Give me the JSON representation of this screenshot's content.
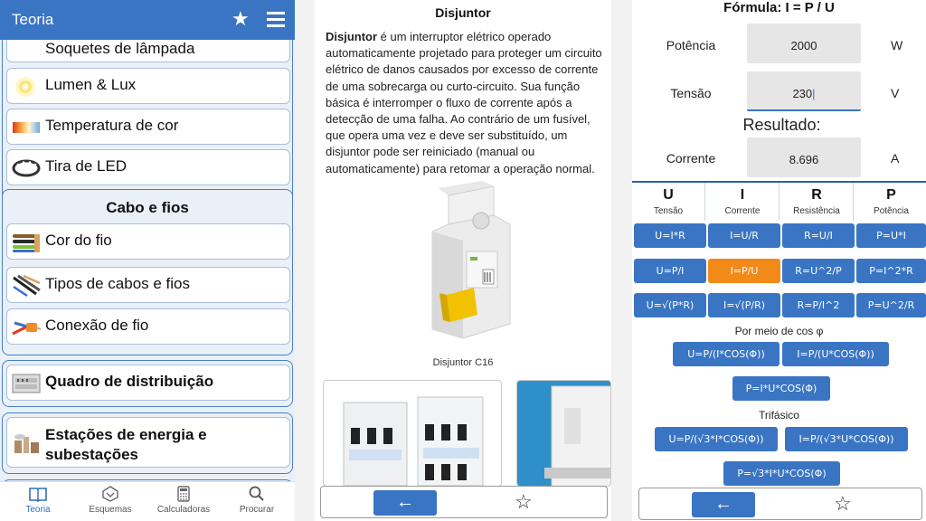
{
  "panel1": {
    "appbar": {
      "title": "Teoria",
      "star_icon": "star-icon",
      "menu_icon": "hamburger-menu-icon"
    },
    "group1_items": [
      {
        "label": "Soquetes de lâmpada",
        "icon": "lamp-socket-icon"
      },
      {
        "label": "Lumen & Lux",
        "icon": "light-bulb-icon"
      },
      {
        "label": "Temperatura de cor",
        "icon": "color-gradient-icon"
      },
      {
        "label": "Tira de LED",
        "icon": "led-strip-icon"
      }
    ],
    "group2": {
      "title": "Cabo e fios",
      "items": [
        {
          "label": "Cor do fio",
          "icon": "wire-colors-icon"
        },
        {
          "label": "Tipos de cabos e fios",
          "icon": "cable-types-icon"
        },
        {
          "label": "Conexão de fio",
          "icon": "wire-connection-icon"
        }
      ]
    },
    "group3_item": {
      "label": "Quadro de distribuição",
      "icon": "distribution-board-icon"
    },
    "group4_item": {
      "label_line1": "Estações de energia e",
      "label_line2": "subestações",
      "icon": "power-station-icon"
    },
    "bottom_nav": [
      {
        "label": "Teoria",
        "icon": "book-icon",
        "active": true
      },
      {
        "label": "Esquemas",
        "icon": "schematic-icon",
        "active": false
      },
      {
        "label": "Calculadoras",
        "icon": "calculator-icon",
        "active": false
      },
      {
        "label": "Procurar",
        "icon": "search-icon",
        "active": false
      }
    ]
  },
  "panel2": {
    "title": "Disjuntor",
    "body_term": "Disjuntor",
    "body_text": " é um interruptor elétrico operado automaticamente projetado para proteger um circuito elétrico de danos causados por excesso de corrente de uma sobrecarga ou curto-circuito. Sua função básica é interromper o fluxo de corrente após a detecção de uma falha. Ao contrário de um fusível, que opera uma vez e deve ser substituído, um disjuntor pode ser reiniciado (manual ou automaticamente) para retomar a operação normal.",
    "image_caption": "Disjuntor C16",
    "back_icon": "arrow-left-icon",
    "favorite_icon": "star-outline-icon"
  },
  "panel3": {
    "formula": "Fórmula: I = P / U",
    "inputs": [
      {
        "label": "Potência",
        "value": "2000",
        "unit": "W"
      },
      {
        "label": "Tensão",
        "value": "230",
        "unit": "V"
      }
    ],
    "result_label": "Resultado:",
    "output": {
      "label": "Corrente",
      "value": "8.696",
      "unit": "A"
    },
    "quantities": [
      {
        "symbol": "U",
        "name": "Tensão"
      },
      {
        "symbol": "I",
        "name": "Corrente"
      },
      {
        "symbol": "R",
        "name": "Resistência"
      },
      {
        "symbol": "P",
        "name": "Potência"
      }
    ],
    "formula_grid": [
      [
        "U=I*R",
        "I=U/R",
        "R=U/I",
        "P=U*I"
      ],
      [
        "U=P/I",
        "I=P/U",
        "R=U^2/P",
        "P=I^2*R"
      ],
      [
        "U=√(P*R)",
        "I=√(P/R)",
        "R=P/I^2",
        "P=U^2/R"
      ]
    ],
    "selected_formula": "I=P/U",
    "cos_title": "Por meio de cos φ",
    "cos_formulas": [
      "U=P/(I*COS(Φ))",
      "I=P/(U*COS(Φ))",
      "P=I*U*COS(Φ)"
    ],
    "tri_title": "Trifásico",
    "tri_formulas": [
      "U=P/(√3*I*COS(Φ))",
      "I=P/(√3*U*COS(Φ))",
      "P=√3*I*U*COS(Φ)"
    ],
    "accent_color": "#3a75c4",
    "selected_color": "#f28a1a"
  }
}
